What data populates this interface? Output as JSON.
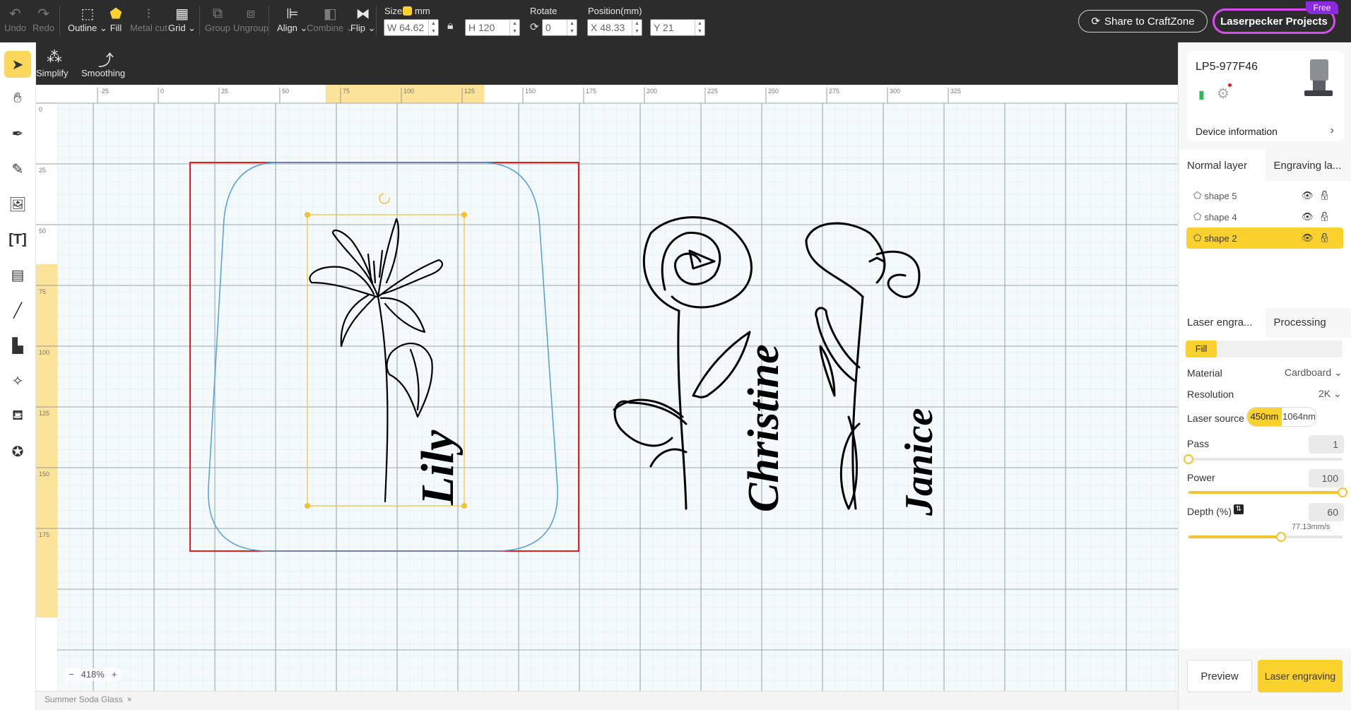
{
  "toolbar": {
    "undo": "Undo",
    "redo": "Redo",
    "outline": "Outline",
    "fill": "Fill",
    "metal_cut": "Metal cut",
    "grid": "Grid",
    "group": "Group",
    "ungroup": "Ungroup",
    "align": "Align",
    "combine": "Combine",
    "flip": "Flip",
    "size_label": "Size",
    "unit": "mm",
    "width": "W 64.62",
    "height": "H 120",
    "rotate_label": "Rotate",
    "rotate_value": "0",
    "position_label": "Position(mm)",
    "x_value": "X 48.33",
    "y_value": "Y 21",
    "share": "Share to CraftZone",
    "projects": "Laserpecker Projects",
    "free": "Free"
  },
  "subbar": {
    "simplify": "Simplify",
    "smoothing": "Smoothing"
  },
  "canvas": {
    "ruler_top": [
      "-25",
      "0",
      "25",
      "50",
      "75",
      "100",
      "125",
      "150",
      "175",
      "200",
      "225",
      "250",
      "275",
      "300",
      "325"
    ],
    "ruler_left": [
      "0",
      "25",
      "50",
      "75",
      "100",
      "125",
      "150",
      "175"
    ],
    "names": [
      "Lily",
      "Christine",
      "Janice"
    ],
    "zoom": "418%"
  },
  "document_tab": "Summer Soda Glass",
  "device": {
    "name": "LP5-977F46",
    "info": "Device information"
  },
  "layer_tabs": [
    "Normal layer",
    "Engraving la..."
  ],
  "layers": [
    {
      "name": "shape 5",
      "selected": false
    },
    {
      "name": "shape 4",
      "selected": false
    },
    {
      "name": "shape 2",
      "selected": true
    }
  ],
  "settings_tabs": [
    "Laser engra...",
    "Processing"
  ],
  "settings": {
    "mode": "Fill",
    "material_label": "Material",
    "material": "Cardboard",
    "resolution_label": "Resolution",
    "resolution": "2K",
    "source_label": "Laser source",
    "source_options": [
      "450nm",
      "1064nm"
    ],
    "pass_label": "Pass",
    "pass": "1",
    "pass_level": 0,
    "power_label": "Power",
    "power": "100",
    "power_level": 1,
    "depth_label": "Depth (%)",
    "depth": "60",
    "speed": "77.13mm/s",
    "depth_level": 0.6
  },
  "actions": {
    "preview": "Preview",
    "engrave": "Laser engraving"
  },
  "colors": {
    "accent": "#fbd12e",
    "toolbar_bg": "#2c2c2c",
    "projects_border": "#d94cf0"
  }
}
